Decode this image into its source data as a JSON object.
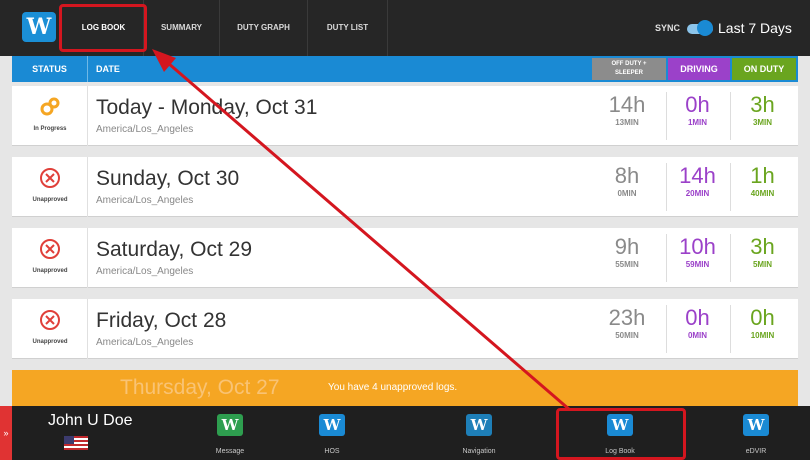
{
  "tabs": [
    {
      "label": "LOG BOOK"
    },
    {
      "label": "SUMMARY"
    },
    {
      "label": "DUTY GRAPH"
    },
    {
      "label": "DUTY LIST"
    }
  ],
  "topbar": {
    "logo_letter": "W",
    "sync_label": "SYNC",
    "range_label": "Last 7 Days"
  },
  "columns": {
    "status": "STATUS",
    "date": "DATE",
    "off_duty_line1": "OFF DUTY +",
    "off_duty_line2": "SLEEPER",
    "driving": "DRIVING",
    "on_duty": "ON DUTY"
  },
  "logs": [
    {
      "status": "In Progress",
      "date": "Today - Monday, Oct 31",
      "timezone": "America/Los_Angeles",
      "off_h": "14h",
      "off_m": "13MIN",
      "drv_h": "0h",
      "drv_m": "1MIN",
      "on_h": "3h",
      "on_m": "3MIN"
    },
    {
      "status": "Unapproved",
      "date": "Sunday, Oct 30",
      "timezone": "America/Los_Angeles",
      "off_h": "8h",
      "off_m": "0MIN",
      "drv_h": "14h",
      "drv_m": "20MIN",
      "on_h": "1h",
      "on_m": "40MIN"
    },
    {
      "status": "Unapproved",
      "date": "Saturday, Oct 29",
      "timezone": "America/Los_Angeles",
      "off_h": "9h",
      "off_m": "55MIN",
      "drv_h": "10h",
      "drv_m": "59MIN",
      "on_h": "3h",
      "on_m": "5MIN"
    },
    {
      "status": "Unapproved",
      "date": "Friday, Oct 28",
      "timezone": "America/Los_Angeles",
      "off_h": "23h",
      "off_m": "50MIN",
      "drv_h": "0h",
      "drv_m": "0MIN",
      "on_h": "0h",
      "on_m": "10MIN"
    }
  ],
  "banner": {
    "ghost_date": "Thursday, Oct 27",
    "message": "You have 4 unapproved logs."
  },
  "bottom": {
    "user_name": "John U Doe",
    "nav": [
      {
        "label": "Message",
        "icon": "message-icon",
        "glyph": "W"
      },
      {
        "label": "HOS",
        "icon": "hos-icon",
        "glyph": "W"
      },
      {
        "label": "Navigation",
        "icon": "navigation-icon",
        "glyph": "W"
      },
      {
        "label": "Log Book",
        "icon": "logbook-icon",
        "glyph": "W"
      },
      {
        "label": "eDVIR",
        "icon": "edvir-icon",
        "glyph": "W"
      }
    ]
  },
  "colors": {
    "accent_blue": "#1a8ad4",
    "driving_purple": "#9b41c9",
    "on_duty_green": "#6aa51f",
    "banner_orange": "#f5a623",
    "highlight_red": "#d4161f"
  }
}
